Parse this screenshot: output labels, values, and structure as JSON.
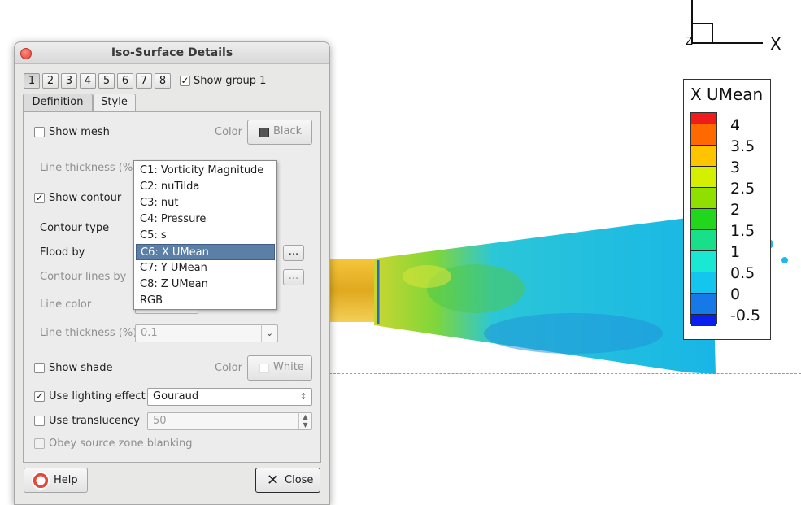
{
  "plot": {
    "axis_x_label": "X",
    "axis_z_label": "Z",
    "legend": {
      "title": "X UMean",
      "levels": [
        "4",
        "3.5",
        "3",
        "2.5",
        "2",
        "1.5",
        "1",
        "0.5",
        "0",
        "-0.5"
      ],
      "colors": [
        "#ee1c1c",
        "#ff6a00",
        "#ffc400",
        "#d4f000",
        "#8fe000",
        "#22d61d",
        "#18e08a",
        "#19e8d3",
        "#14c5ee",
        "#1778e8",
        "#0a1ef0"
      ]
    }
  },
  "dialog": {
    "title": "Iso-Surface Details",
    "groups": [
      "1",
      "2",
      "3",
      "4",
      "5",
      "6",
      "7",
      "8"
    ],
    "active_group": "1",
    "show_group_label": "Show group 1",
    "show_group_checked": true,
    "tabs": [
      "Definition",
      "Style"
    ],
    "active_tab": "Style",
    "show_mesh": {
      "label": "Show mesh",
      "checked": false,
      "color_label": "Color",
      "color_value": "Black"
    },
    "line_thickness_pct_label": "Line thickness (%):",
    "show_contour": {
      "label": "Show contour",
      "checked": true
    },
    "contour_type_label": "Contour type",
    "flood_by_label": "Flood by",
    "contour_lines_by_label": "Contour lines by",
    "line_color_label": "Line color",
    "line_thickness_label": "Line thickness (%)",
    "line_thickness_value": "0.1",
    "ellipsis": "...",
    "flood_dropdown": {
      "items": [
        "C1: Vorticity Magnitude",
        "C2: nuTilda",
        "C3: nut",
        "C4: Pressure",
        "C5: s",
        "C6: X UMean",
        "C7: Y UMean",
        "C8: Z UMean",
        "RGB"
      ],
      "selected": "C6: X UMean"
    },
    "show_shade": {
      "label": "Show shade",
      "checked": false,
      "color_label": "Color",
      "color_value": "White"
    },
    "lighting": {
      "label": "Use lighting effect",
      "checked": true,
      "value": "Gouraud"
    },
    "translucency": {
      "label": "Use translucency",
      "checked": false,
      "value": "50"
    },
    "obey_blanking": {
      "label": "Obey source zone blanking",
      "checked": false
    },
    "help_label": "Help",
    "close_label": "Close"
  }
}
